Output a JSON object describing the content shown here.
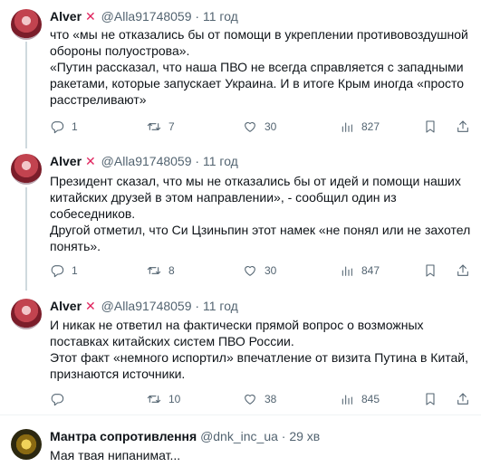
{
  "tweets": [
    {
      "name": "Alver",
      "handle": "@Alla91748059",
      "dot": "·",
      "time": "11 год",
      "lines": [
        "что «мы не отказались бы от помощи в укреплении противовоздушной",
        "обороны полуострова».",
        "«Путин рассказал, что наша ПВО не всегда справляется  с западными",
        "ракетами, которые запускает Украина. И в итоге Крым иногда «просто",
        "расстреливают»"
      ],
      "replies": "1",
      "retweets": "7",
      "likes": "30",
      "views": "827"
    },
    {
      "name": "Alver",
      "handle": "@Alla91748059",
      "dot": "·",
      "time": "11 год",
      "lines": [
        "Президент сказал, что мы не отказались бы от идей и помощи наших",
        "китайских друзей в этом направлении», - сообщил один из",
        "собеседников.",
        "Другой отметил, что Си Цзиньпин этот намек «не понял или не захотел",
        "понять»."
      ],
      "replies": "1",
      "retweets": "8",
      "likes": "30",
      "views": "847"
    },
    {
      "name": "Alver",
      "handle": "@Alla91748059",
      "dot": "·",
      "time": "11 год",
      "lines": [
        "И никак не ответил на фактически прямой вопрос о возможных",
        "поставках китайских систем ПВО России.",
        "Этот факт «немного испортил» впечатление от визита Путина в Китай,",
        "признаются источники."
      ],
      "replies": "",
      "retweets": "10",
      "likes": "38",
      "views": "845"
    },
    {
      "name": "Мантра сопротивлення",
      "handle": "@dnk_inc_ua",
      "dot": "·",
      "time": "29 хв",
      "lines": [
        "Мая твая нипанимат..."
      ]
    }
  ],
  "colors": {
    "text": "#0f1419",
    "muted": "#536471",
    "x_mark": "#e0245e",
    "divider": "#eff3f4"
  },
  "icons": [
    "reply-icon",
    "retweet-icon",
    "like-icon",
    "views-icon",
    "bookmark-icon",
    "share-icon",
    "cross-mark-icon"
  ]
}
